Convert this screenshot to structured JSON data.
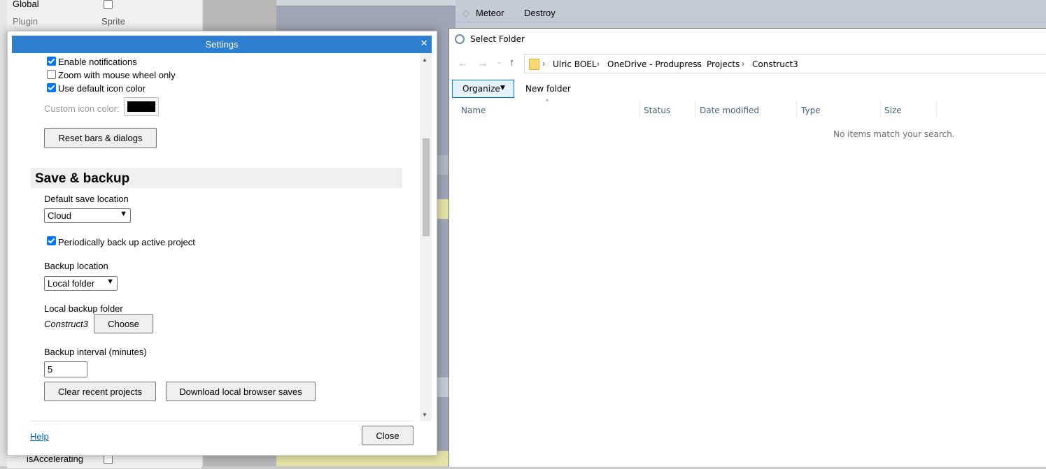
{
  "background": {
    "props": [
      {
        "name": "Global",
        "value": ""
      },
      {
        "name": "Plugin",
        "value": "Sprite"
      },
      {
        "name": "isAccelerating",
        "value": ""
      }
    ],
    "events": [
      {
        "object": "Meteor",
        "action": "Destroy"
      }
    ]
  },
  "settings": {
    "title": "Settings",
    "close_icon": "×",
    "enable_notifications": "Enable notifications",
    "zoom_wheel": "Zoom with mouse wheel only",
    "default_icon_color": "Use default icon color",
    "custom_icon_color": "Custom icon color:",
    "custom_icon_color_value": "#000000",
    "reset_bars": "Reset bars & dialogs",
    "section_title": "Save & backup",
    "default_save_location_label": "Default save location",
    "default_save_location_value": "Cloud",
    "periodic_backup": "Periodically back up active project",
    "backup_location_label": "Backup location",
    "backup_location_value": "Local folder",
    "local_backup_folder_label": "Local backup folder",
    "local_backup_folder_value": "Construct3",
    "choose": "Choose",
    "backup_interval_label": "Backup interval (minutes)",
    "backup_interval_value": "5",
    "clear_recent": "Clear recent projects",
    "download_saves": "Download local browser saves",
    "help": "Help",
    "close": "Close"
  },
  "file_dialog": {
    "title": "Select Folder",
    "breadcrumbs": [
      "Ulric BOEL",
      "OneDrive - Produpress",
      "Projects",
      "Construct3"
    ],
    "organize": "Organize",
    "new_folder": "New folder",
    "columns": [
      "Name",
      "Status",
      "Date modified",
      "Type",
      "Size"
    ],
    "empty_message": "No items match your search."
  },
  "colors": {
    "title_bar": "#2f7fd1",
    "checkbox_accent": "#0075ff",
    "organize_border": "#0078d7"
  }
}
